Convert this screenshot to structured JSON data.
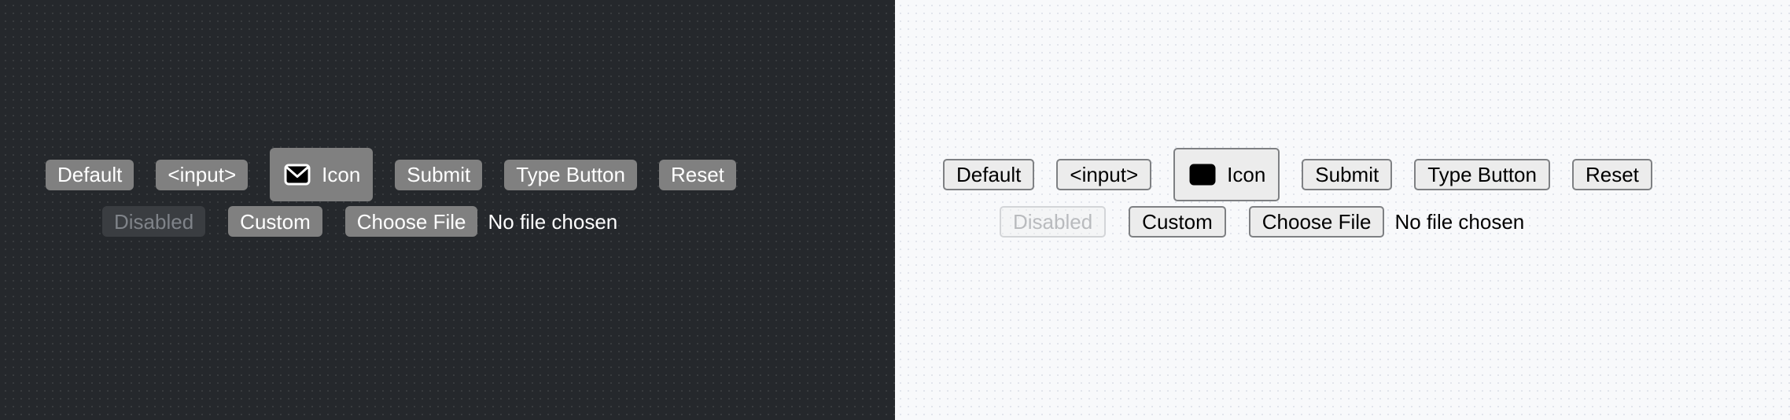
{
  "theme": {
    "dark": {
      "name": "dark-panel",
      "background": "#25282c",
      "button_fill": "#808080",
      "button_text": "#ffffff",
      "disabled_fill": "#3a3d41",
      "disabled_text": "#7f8389"
    },
    "light": {
      "name": "light-panel",
      "background": "#f8f9fb",
      "button_fill": "#ececec",
      "button_text": "#000000",
      "button_border": "#7e8083",
      "disabled_text": "#b9bbbe"
    }
  },
  "buttons": {
    "row1": [
      {
        "label": "Default",
        "name": "default-button"
      },
      {
        "label": "<input>",
        "name": "input-button"
      },
      {
        "label": "Icon",
        "name": "icon-button",
        "icon": "envelope-icon"
      },
      {
        "label": "Submit",
        "name": "submit-button"
      },
      {
        "label": "Type Button",
        "name": "type-button"
      },
      {
        "label": "Reset",
        "name": "reset-button"
      }
    ],
    "row2": [
      {
        "label": "Disabled",
        "name": "disabled-button"
      },
      {
        "label": "Custom",
        "name": "custom-button"
      }
    ]
  },
  "file_input": {
    "button_label": "Choose File",
    "status_text": "No file chosen"
  }
}
